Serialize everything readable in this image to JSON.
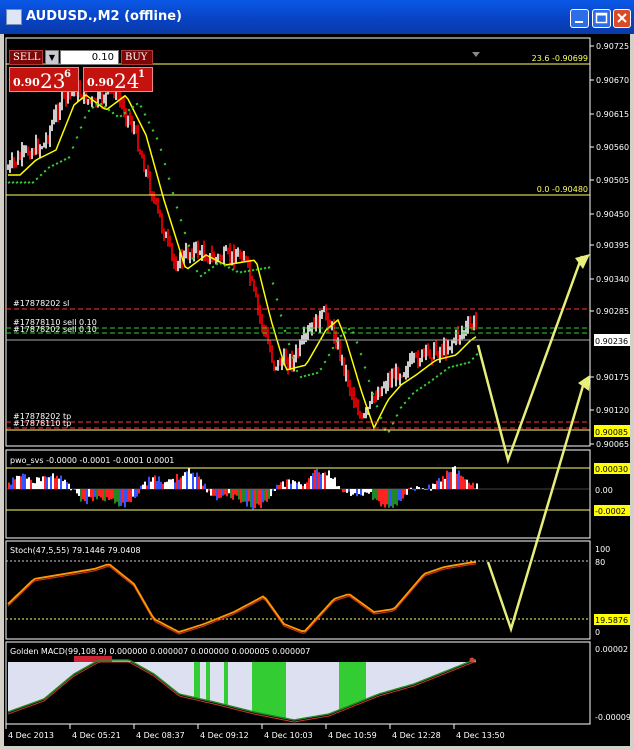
{
  "window": {
    "title": "AUDUSD.,M2 (offline)"
  },
  "trade_panel": {
    "sell_label": "SELL",
    "buy_label": "BUY",
    "lot_value": "0.10",
    "sell_price": {
      "main": "0.90",
      "big": "23",
      "sup": "6"
    },
    "buy_price": {
      "main": "0.90",
      "big": "24",
      "sup": "1"
    }
  },
  "main_chart": {
    "price_axis": [
      "0.90725",
      "0.90670",
      "0.90615",
      "0.90560",
      "0.90505",
      "0.90450",
      "0.90395",
      "0.90340",
      "0.90285",
      "0.90175",
      "0.90120",
      "0.90065"
    ],
    "current_price": "0.90236",
    "marked_price": "0.90085",
    "fib_upper": "23.6 -0.90699",
    "fib_lower": "0.0 -0.90480",
    "order_labels": [
      "#17878202 sl",
      "#17878110 sell 0.10",
      "#17878202 sell 0.10",
      "#17878202 tp",
      "#17878110 tp"
    ]
  },
  "pwo_panel": {
    "label": "pwo_svs -0.0000 -0.0001 -0.0001 0.0001",
    "level_upper": "0.00030",
    "level_zero": "0.00",
    "level_lower": "-0.0002"
  },
  "stoch_panel": {
    "label": "Stoch(47,5,55) 79.1446 79.0408",
    "axis": [
      "100",
      "80",
      "0"
    ],
    "level_marker": "19.5876"
  },
  "macd_panel": {
    "label": "Golden MACD(99,108,9) 0.000000 0.000007 0.000000 0.000005 0.000007",
    "axis_top": "0.00002",
    "axis_bottom": "-0.00009"
  },
  "time_axis": [
    "4 Dec 2013",
    "4 Dec 05:21",
    "4 Dec 08:37",
    "4 Dec 09:12",
    "4 Dec 10:03",
    "4 Dec 10:59",
    "4 Dec 12:28",
    "4 Dec 13:50"
  ],
  "colors": {
    "background": "#000000",
    "grid": "#ffffff",
    "bull_candle": "#ffffff",
    "bear_candle": "#ff0000",
    "ma_yellow": "#ffff00",
    "ma_green": "#33cc33",
    "arrow": "#e8ee7a",
    "stoch_line": "#ff9900",
    "macd_green": "#33cc33"
  }
}
